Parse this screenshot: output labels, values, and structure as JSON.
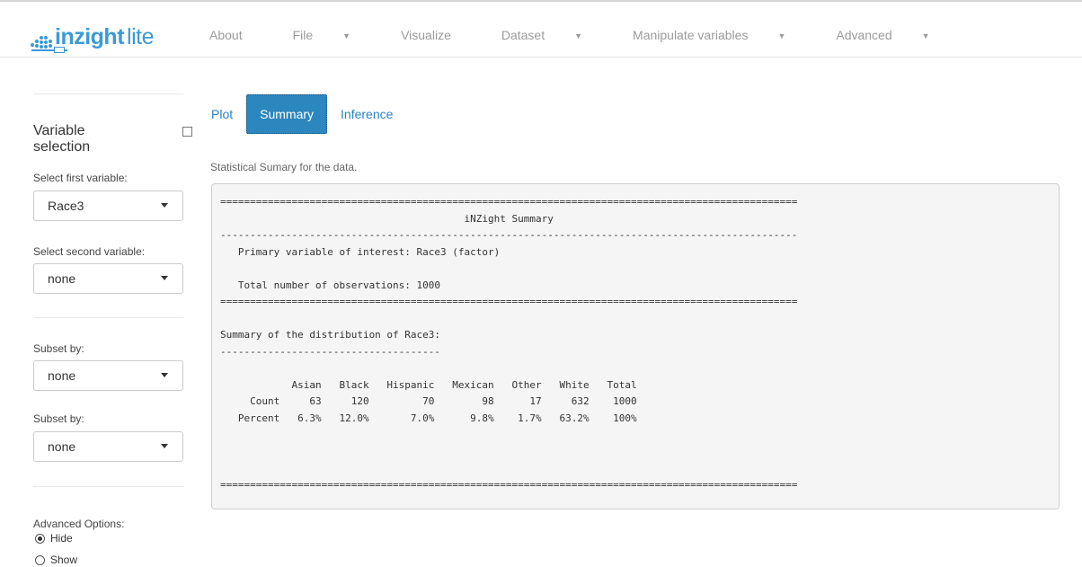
{
  "app": {
    "brand_name": "inzight",
    "brand_suffix": "lite",
    "accent_color": "#3b9ad6"
  },
  "nav": {
    "items": [
      {
        "label": "About",
        "dropdown": false
      },
      {
        "label": "File",
        "dropdown": true
      },
      {
        "label": "Visualize",
        "dropdown": false,
        "active": true
      },
      {
        "label": "Dataset",
        "dropdown": true
      },
      {
        "label": "Manipulate variables",
        "dropdown": true
      },
      {
        "label": "Advanced",
        "dropdown": true
      }
    ]
  },
  "sidebar": {
    "title": "Variable selection",
    "first_var_label": "Select first variable:",
    "first_var_value": "Race3",
    "second_var_label": "Select second variable:",
    "second_var_value": "none",
    "subset1_label": "Subset by:",
    "subset1_value": "none",
    "subset2_label": "Subset by:",
    "subset2_value": "none",
    "advanced_label": "Advanced Options:",
    "advanced_options": [
      {
        "label": "Hide",
        "selected": true
      },
      {
        "label": "Show",
        "selected": false
      }
    ]
  },
  "main": {
    "tabs": [
      {
        "label": "Plot",
        "active": false
      },
      {
        "label": "Summary",
        "active": true
      },
      {
        "label": "Inference",
        "active": false
      }
    ],
    "caption": "Statistical Sumary for the data.",
    "summary_text": "=================================================================================================\n                                         iNZight Summary\n-------------------------------------------------------------------------------------------------\n   Primary variable of interest: Race3 (factor)\n\n   Total number of observations: 1000\n=================================================================================================\n\nSummary of the distribution of Race3:\n-------------------------------------\n\n            Asian   Black   Hispanic   Mexican   Other   White   Total\n     Count     63     120         70        98      17     632    1000\n   Percent   6.3%   12.0%       7.0%      9.8%    1.7%   63.2%    100%\n\n\n\n================================================================================================="
  }
}
